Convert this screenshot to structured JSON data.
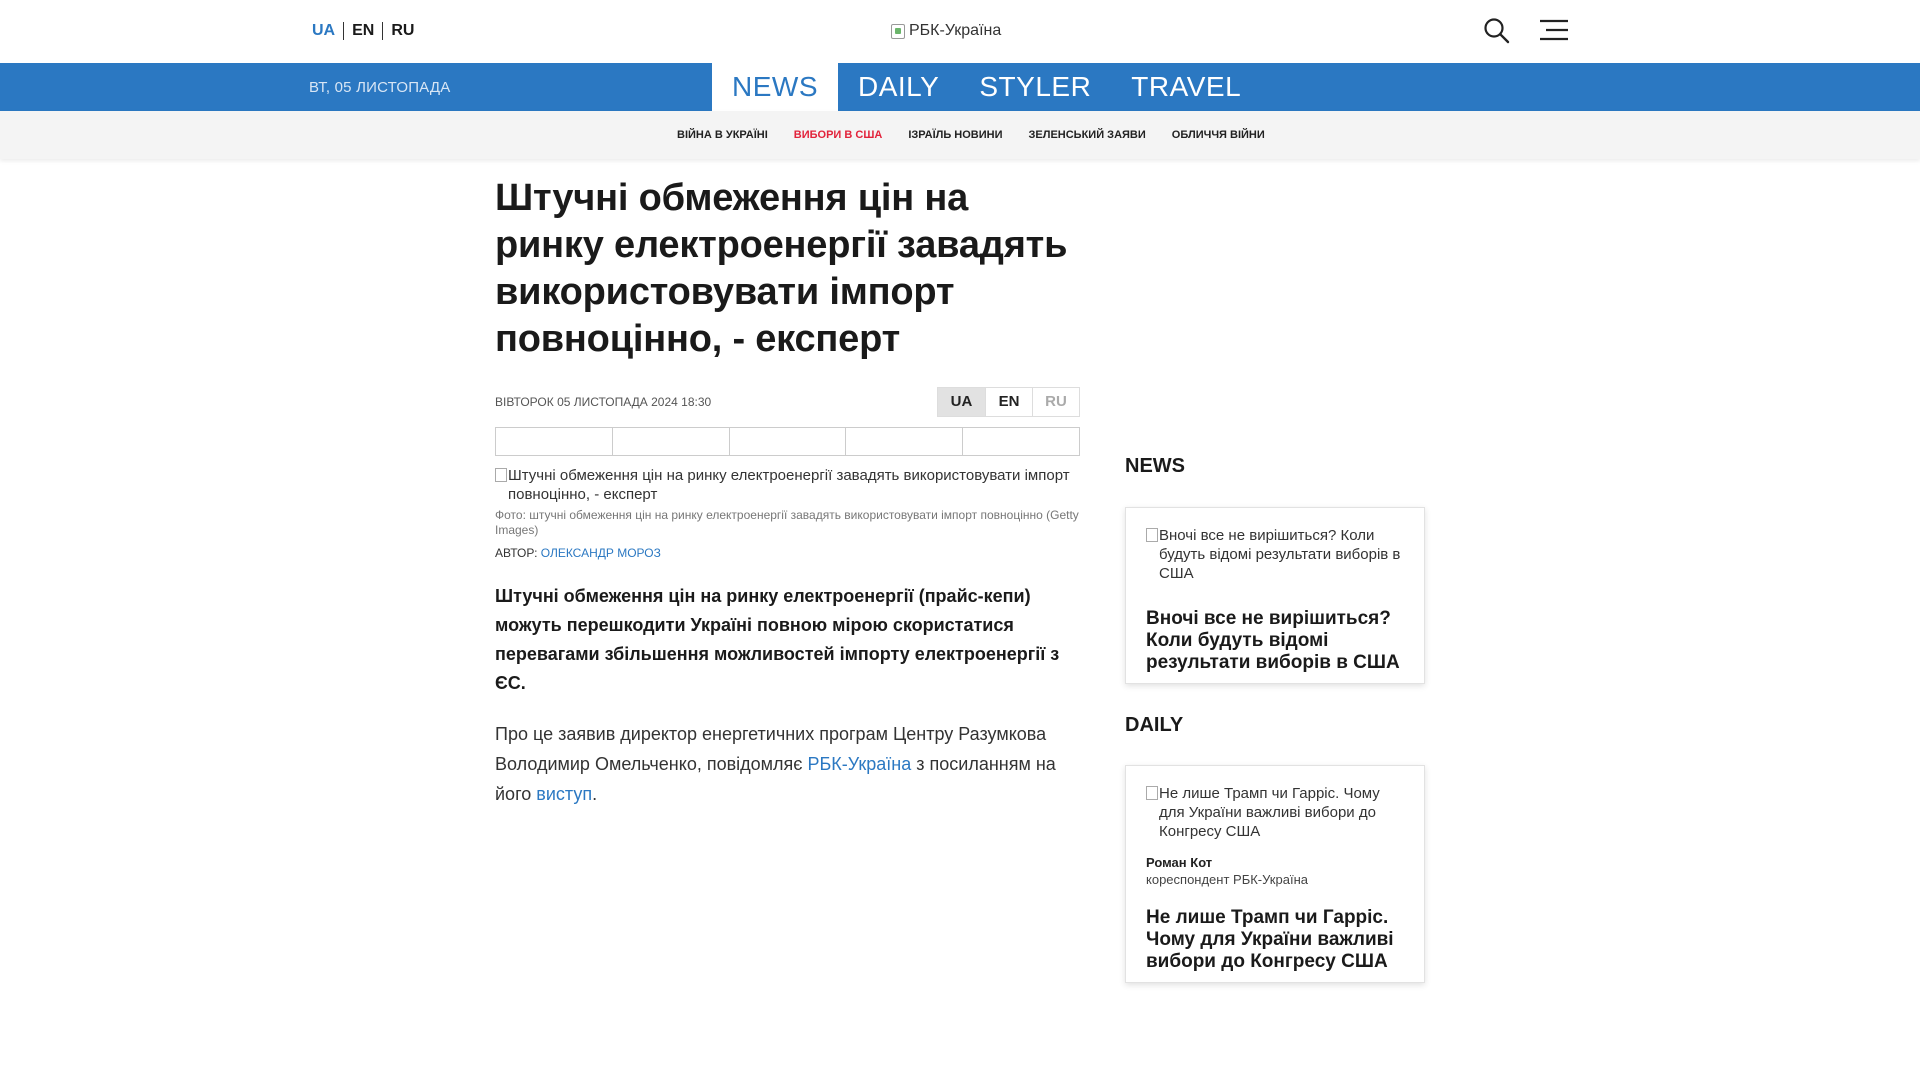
{
  "header": {
    "langs": [
      "UA",
      "EN",
      "RU"
    ],
    "logo_alt": "РБК-Україна"
  },
  "nav": {
    "date": "ВТ, 05 ЛИСТОПАДА",
    "sections": [
      "NEWS",
      "DAILY",
      "STYLER",
      "TRAVEL"
    ]
  },
  "tags": [
    "ВІЙНА В УКРАЇНІ",
    "ВИБОРИ В США",
    "ІЗРАЇЛЬ НОВИНИ",
    "ЗЕЛЕНСЬКИЙ ЗАЯВИ",
    "ОБЛИЧЧЯ ВІЙНИ"
  ],
  "article": {
    "headline": "Штучні обмеження цін на ринку електроенергії завадять використовувати імпорт повноцінно, - експерт",
    "pubdate": "ВІВТОРОК 05 ЛИСТОПАДА 2024 18:30",
    "langs": [
      "UA",
      "EN",
      "RU"
    ],
    "image_alt": "Штучні обмеження цін на ринку електроенергії завадять використовувати імпорт повноцінно, - експерт",
    "caption": "Фото: штучні обмеження цін на ринку електроенергії завадять використовувати імпорт повноцінно (Getty Images)",
    "author_label": "АВТОР:",
    "author_name": "ОЛЕКСАНДР МОРОЗ",
    "lead": "Штучні обмеження цін на ринку електроенергії (прайс-кепи) можуть перешкодити Україні повною мірою скористатися перевагами збільшення можливостей імпорту електроенергії з ЄС.",
    "body_1": "Про це заявив директор енергетичних програм Центру Разумкова Володимир Омельченко, повідомляє ",
    "body_link1": "РБК-Україна",
    "body_2": " з посиланням на його ",
    "body_link2": "виступ",
    "body_3": "."
  },
  "sidebar": {
    "news_heading": "NEWS",
    "news_card": {
      "image_alt": "Вночі все не вирішиться? Коли будуть відомі результати виборів в США",
      "title": "Вночі все не вирішиться? Коли будуть відомі результати виборів в США"
    },
    "daily_heading": "DAILY",
    "daily_card": {
      "image_alt": "Не лише Трамп чи Гарріс. Чому для України важливі вибори до Конгресу США",
      "author": "Роман Кот",
      "role": "кореспондент РБК-Україна",
      "title": "Не лише Трамп чи Гарріс. Чому для України важливі вибори до Конгресу США"
    }
  }
}
